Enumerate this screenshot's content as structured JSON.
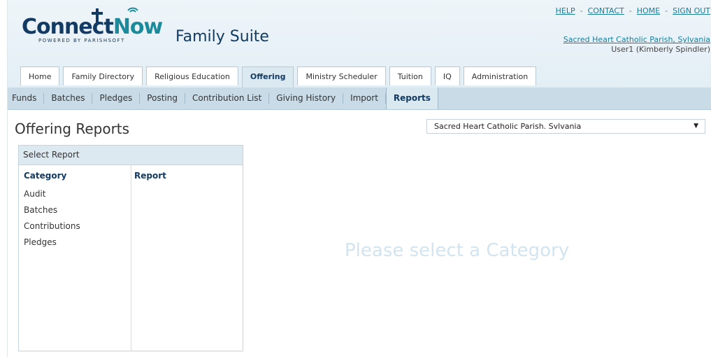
{
  "brand": {
    "logo_main": "Connect",
    "logo_now": "Now",
    "logo_sub": "POWERED BY PARISHSOFT",
    "suite_title": "Family Suite"
  },
  "top_links": [
    "HELP",
    "CONTACT",
    "HOME",
    "SIGN OUT"
  ],
  "top_links_separator": "-",
  "parish_link": "Sacred Heart Catholic Parish, Sylvania",
  "user_line": "User1 (Kimberly Spindler)",
  "main_tabs": [
    {
      "label": "Home",
      "active": false
    },
    {
      "label": "Family Directory",
      "active": false
    },
    {
      "label": "Religious Education",
      "active": false
    },
    {
      "label": "Offering",
      "active": true
    },
    {
      "label": "Ministry Scheduler",
      "active": false
    },
    {
      "label": "Tuition",
      "active": false
    },
    {
      "label": "IQ",
      "active": false
    },
    {
      "label": "Administration",
      "active": false
    }
  ],
  "sub_nav": [
    {
      "label": "Funds",
      "active": false
    },
    {
      "label": "Batches",
      "active": false
    },
    {
      "label": "Pledges",
      "active": false
    },
    {
      "label": "Posting",
      "active": false
    },
    {
      "label": "Contribution List",
      "active": false
    },
    {
      "label": "Giving History",
      "active": false
    },
    {
      "label": "Import",
      "active": false
    },
    {
      "label": "Reports",
      "active": true
    }
  ],
  "page": {
    "title": "Offering Reports",
    "parish_select_value": "Sacred Heart Catholic Parish. Svlvania",
    "select_arrow_icon": "caret-down-icon"
  },
  "panel": {
    "title": "Select Report",
    "category_header": "Category",
    "report_header": "Report",
    "categories": [
      "Audit",
      "Batches",
      "Contributions",
      "Pledges"
    ]
  },
  "placeholder_text": "Please select a Category",
  "colors": {
    "navy": "#123a63",
    "teal": "#1b8a9a",
    "link": "#1b7c9a",
    "subnav_bg": "#c8dbe7",
    "placeholder": "#d2e4ef"
  }
}
